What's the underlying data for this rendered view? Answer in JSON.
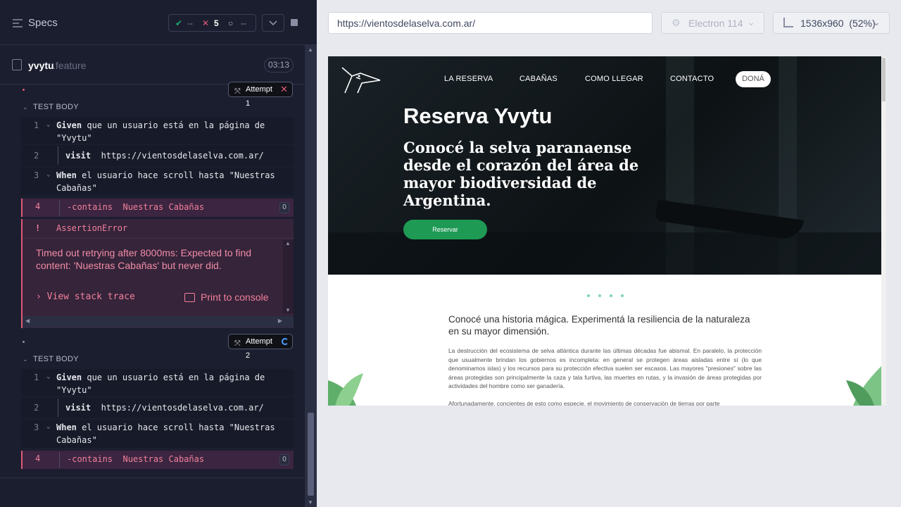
{
  "reporter": {
    "specs_label": "Specs",
    "stats": {
      "passed": "--",
      "failed": "5",
      "pending": "--"
    },
    "file": {
      "name": "yvytu",
      "ext": ".feature",
      "duration": "03:13"
    },
    "attempts": [
      {
        "label": "Attempt 1",
        "status": "failed"
      },
      {
        "label": "Attempt 2",
        "status": "running"
      }
    ],
    "test_body_label": "TEST BODY",
    "commands": [
      {
        "num": "1",
        "keyword": "Given",
        "text": " que un usuario está en la página de \"Yvytu\""
      },
      {
        "num": "2",
        "keyword": "visit",
        "text": "https://vientosdelaselva.com.ar/"
      },
      {
        "num": "3",
        "keyword": "When",
        "text": " el usuario hace scroll hasta \"Nuestras Cabañas\""
      },
      {
        "num": "4",
        "keyword": "-contains",
        "text": "Nuestras Cabañas",
        "count": "0"
      }
    ],
    "error": {
      "marker": "!",
      "name": "AssertionError",
      "message": "Timed out retrying after 8000ms: Expected to find content: 'Nuestras Cabañas' but never did.",
      "stack_label": "View stack trace",
      "print_label": "Print to console"
    }
  },
  "runner": {
    "url": "https://vientosdelaselva.com.ar/",
    "browser": "Electron 114",
    "viewport": "1536x960",
    "scale": "(52%)"
  },
  "site": {
    "nav": [
      "LA RESERVA",
      "CABAÑAS",
      "COMO LLEGAR",
      "CONTACTO"
    ],
    "donate": "DONÁ",
    "title": "Reserva Yvytu",
    "subtitle": "Conocé la selva paranaense desde el corazón del área de mayor biodiversidad de Argentina.",
    "cta": "Reservar",
    "intro": "Conocé una historia mágica. Experimentá la resiliencia de la naturaleza en su mayor dimensión.",
    "paragraph": "La destrucción del ecosistema de selva atlántica durante las últimas décadas fue abismal. En paralelo, la protección que usualmente brindan los gobiernos es incompleta: en general se protegen áreas aisladas entre sí (lo que denominamos islas) y los recursos para su protección efectiva suelen ser escasos. Las mayores \"presiones\" sobre las áreas protegidas son principalmente la caza y tala furtiva, las muertes en rutas, y la invasión de áreas protegidas por actividades del hombre como ser ganadería.",
    "paragraph2": "Afortunadamente, concientes de esto como especie, el movimiento de conservación de tierras por parte"
  },
  "colors": {
    "panel": "#1b1e2e",
    "fail": "#e05a78",
    "accent_green": "#1f9a55"
  }
}
